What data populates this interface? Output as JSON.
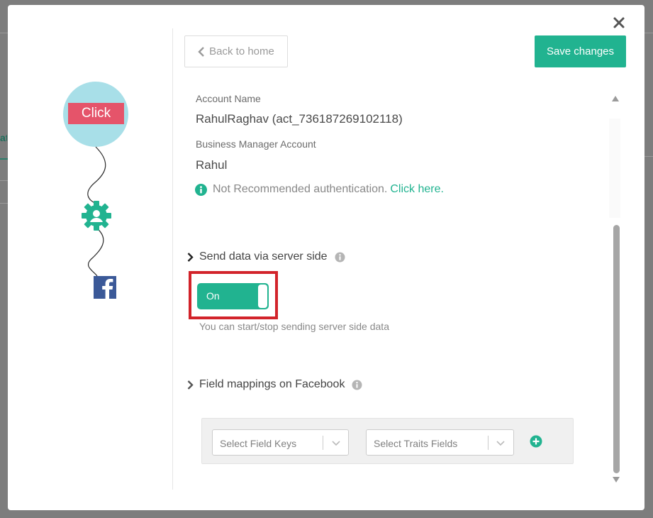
{
  "backdrop": {
    "tab_fragment": "at"
  },
  "flow": {
    "click_label": "Click",
    "node_icons": [
      "gear-user-icon",
      "facebook-icon"
    ]
  },
  "header": {
    "back_label": "Back to home",
    "save_label": "Save changes"
  },
  "account": {
    "name_label": "Account Name",
    "name_value": "RahulRaghav (act_736187269102118)",
    "business_label": "Business Manager Account",
    "business_value": "Rahul",
    "notice_text": "Not Recommended authentication.",
    "notice_link": "Click here."
  },
  "server_side": {
    "heading": "Send data via server side",
    "toggle_label": "On",
    "toggle_state": true,
    "help_text": "You can start/stop sending server side data"
  },
  "field_mappings": {
    "heading": "Field mappings on Facebook",
    "field_keys_placeholder": "Select Field Keys",
    "traits_placeholder": "Select Traits Fields"
  },
  "colors": {
    "accent": "#21b390",
    "click_badge": "#e5546a",
    "highlight": "#d2232a",
    "facebook": "#3b5998",
    "bubble": "#a8dfe8"
  }
}
